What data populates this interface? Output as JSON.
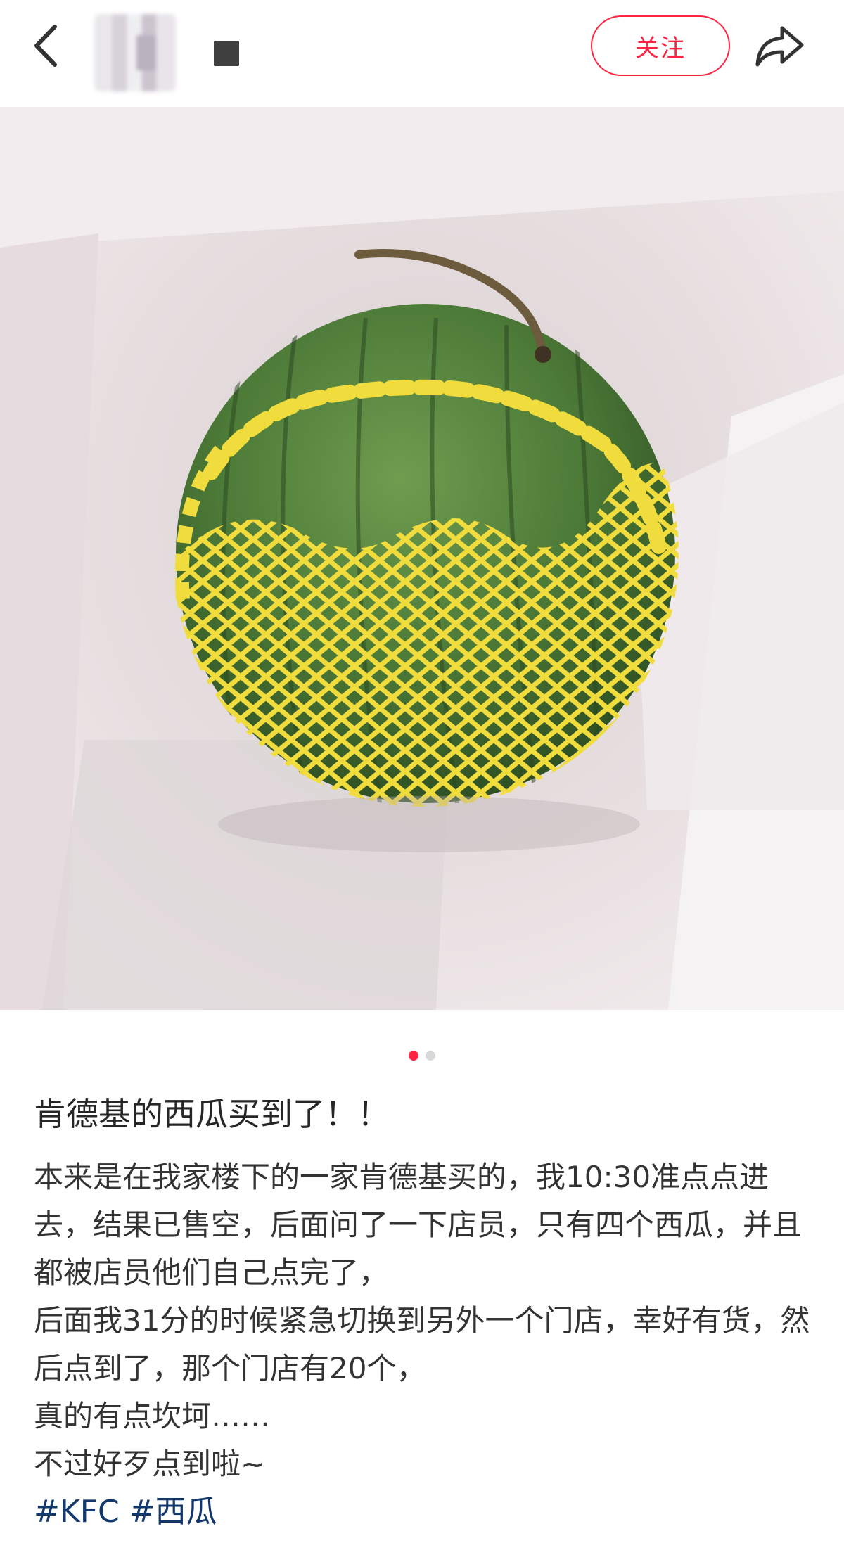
{
  "header": {
    "back_icon": "chevron-left-icon",
    "follow_label": "关注",
    "share_icon": "share-arrow-icon",
    "follow_color": "#ff2442"
  },
  "carousel": {
    "current": 1,
    "total": 2
  },
  "post": {
    "title": "肯德基的西瓜买到了！！",
    "paragraphs": [
      "本来是在我家楼下的一家肯德基买的，我10:30准点点进去，结果已售空，后面问了一下店员，只有四个西瓜，并且都被店员他们自己点完了，",
      "后面我31分的时候紧急切换到另外一个门店，幸好有货，然后点到了，那个门店有20个，",
      "真的有点坎坷……",
      "不过好歹点到啦~"
    ],
    "tags": [
      "#KFC",
      "#西瓜"
    ]
  },
  "colors": {
    "accent": "#ff2442",
    "tag": "#13386c",
    "watermelon": "#4f7f3a",
    "foam_net": "#f2dc3c"
  }
}
